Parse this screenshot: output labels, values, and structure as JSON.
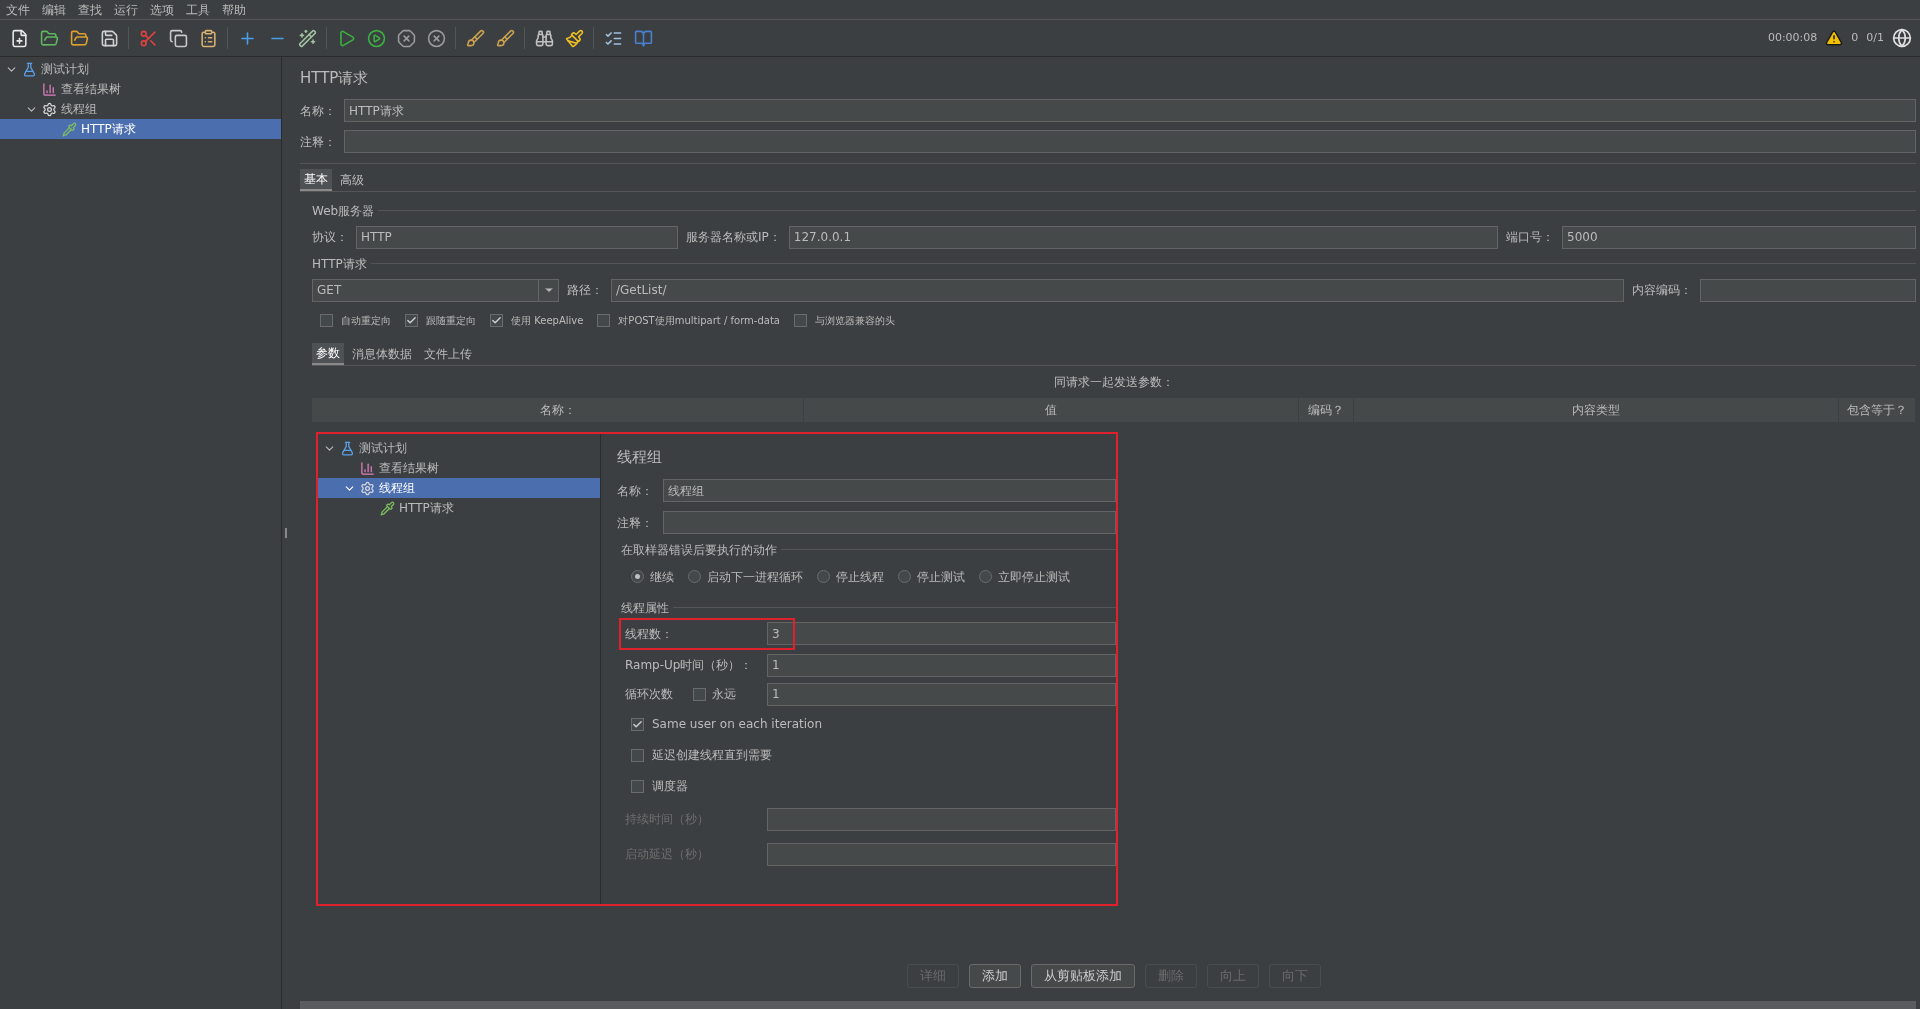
{
  "menu_bar": [
    "文件",
    "编辑",
    "查找",
    "运行",
    "选项",
    "工具",
    "帮助"
  ],
  "status": {
    "elapsed": "00:00:08",
    "warnings": "0",
    "threads": "0/1"
  },
  "tree": [
    {
      "label": "测试计划",
      "kind": "plan",
      "expanded": true,
      "selected": false,
      "children": [
        {
          "label": "查看结果树",
          "kind": "listener",
          "selected": false
        },
        {
          "label": "线程组",
          "kind": "thread-group",
          "expanded": true,
          "selected": false,
          "children": [
            {
              "label": "HTTP请求",
              "kind": "sampler",
              "selected": true
            }
          ]
        }
      ]
    }
  ],
  "editor": {
    "title": "HTTP请求",
    "name_label": "名称：",
    "name": "HTTP请求",
    "comment_label": "注释：",
    "tabs": [
      {
        "label": "基本",
        "selected": true
      },
      {
        "label": "高级",
        "selected": false
      }
    ],
    "web_server": {
      "legend": "Web服务器",
      "protocol_label": "协议：",
      "protocol": "HTTP",
      "server_label": "服务器名称或IP：",
      "server": "127.0.0.1",
      "port_label": "端口号：",
      "port": "5000"
    },
    "http_request": {
      "legend": "HTTP请求",
      "method": "GET",
      "path_label": "路径：",
      "path": "/GetList/",
      "encoding_label": "内容编码："
    },
    "options": [
      {
        "label": "自动重定向",
        "checked": false
      },
      {
        "label": "跟随重定向",
        "checked": true
      },
      {
        "label": "使用 KeepAlive",
        "checked": true
      },
      {
        "label": "对POST使用multipart / form-data",
        "checked": false
      },
      {
        "label": "与浏览器兼容的头",
        "checked": false
      }
    ],
    "body_tabs": [
      {
        "label": "参数",
        "selected": true
      },
      {
        "label": "消息体数据",
        "selected": false
      },
      {
        "label": "文件上传",
        "selected": false
      }
    ],
    "params_caption": "同请求一起发送参数：",
    "columns": [
      "名称：",
      "值",
      "编码？",
      "内容类型",
      "包含等于？"
    ],
    "buttons": [
      {
        "label": "详细",
        "disabled": true
      },
      {
        "label": "添加",
        "disabled": false
      },
      {
        "label": "从剪贴板添加",
        "disabled": false
      },
      {
        "label": "删除",
        "disabled": true
      },
      {
        "label": "向上",
        "disabled": true
      },
      {
        "label": "向下",
        "disabled": true
      }
    ]
  },
  "inset_screenshot": {
    "tree": [
      {
        "label": "测试计划",
        "kind": "plan",
        "expanded": true,
        "selected": false,
        "children": [
          {
            "label": "查看结果树",
            "kind": "listener",
            "selected": false
          },
          {
            "label": "线程组",
            "kind": "thread-group",
            "expanded": true,
            "selected": true,
            "children": [
              {
                "label": "HTTP请求",
                "kind": "sampler",
                "selected": false
              }
            ]
          }
        ]
      }
    ],
    "title": "线程组",
    "name_label": "名称：",
    "name": "线程组",
    "comment_label": "注释：",
    "error_legend": "在取样器错误后要执行的动作",
    "error_actions": [
      {
        "label": "继续",
        "selected": true
      },
      {
        "label": "启动下一进程循环",
        "selected": false
      },
      {
        "label": "停止线程",
        "selected": false
      },
      {
        "label": "停止测试",
        "selected": false
      },
      {
        "label": "立即停止测试",
        "selected": false
      }
    ],
    "props_legend": "线程属性",
    "threads_label": "线程数：",
    "threads": "3",
    "threads_highlighted": true,
    "rampup_label": "Ramp-Up时间（秒）：",
    "rampup": "1",
    "loop_label": "循环次数",
    "forever_label": "永远",
    "forever": false,
    "loops": "1",
    "checks": [
      {
        "label": "Same user on each iteration",
        "checked": true
      },
      {
        "label": "延迟创建线程直到需要",
        "checked": false
      },
      {
        "label": "调度器",
        "checked": false
      }
    ],
    "duration_label": "持续时间（秒）",
    "delay_label": "启动延迟（秒）",
    "scheduler_fields_disabled": true
  }
}
